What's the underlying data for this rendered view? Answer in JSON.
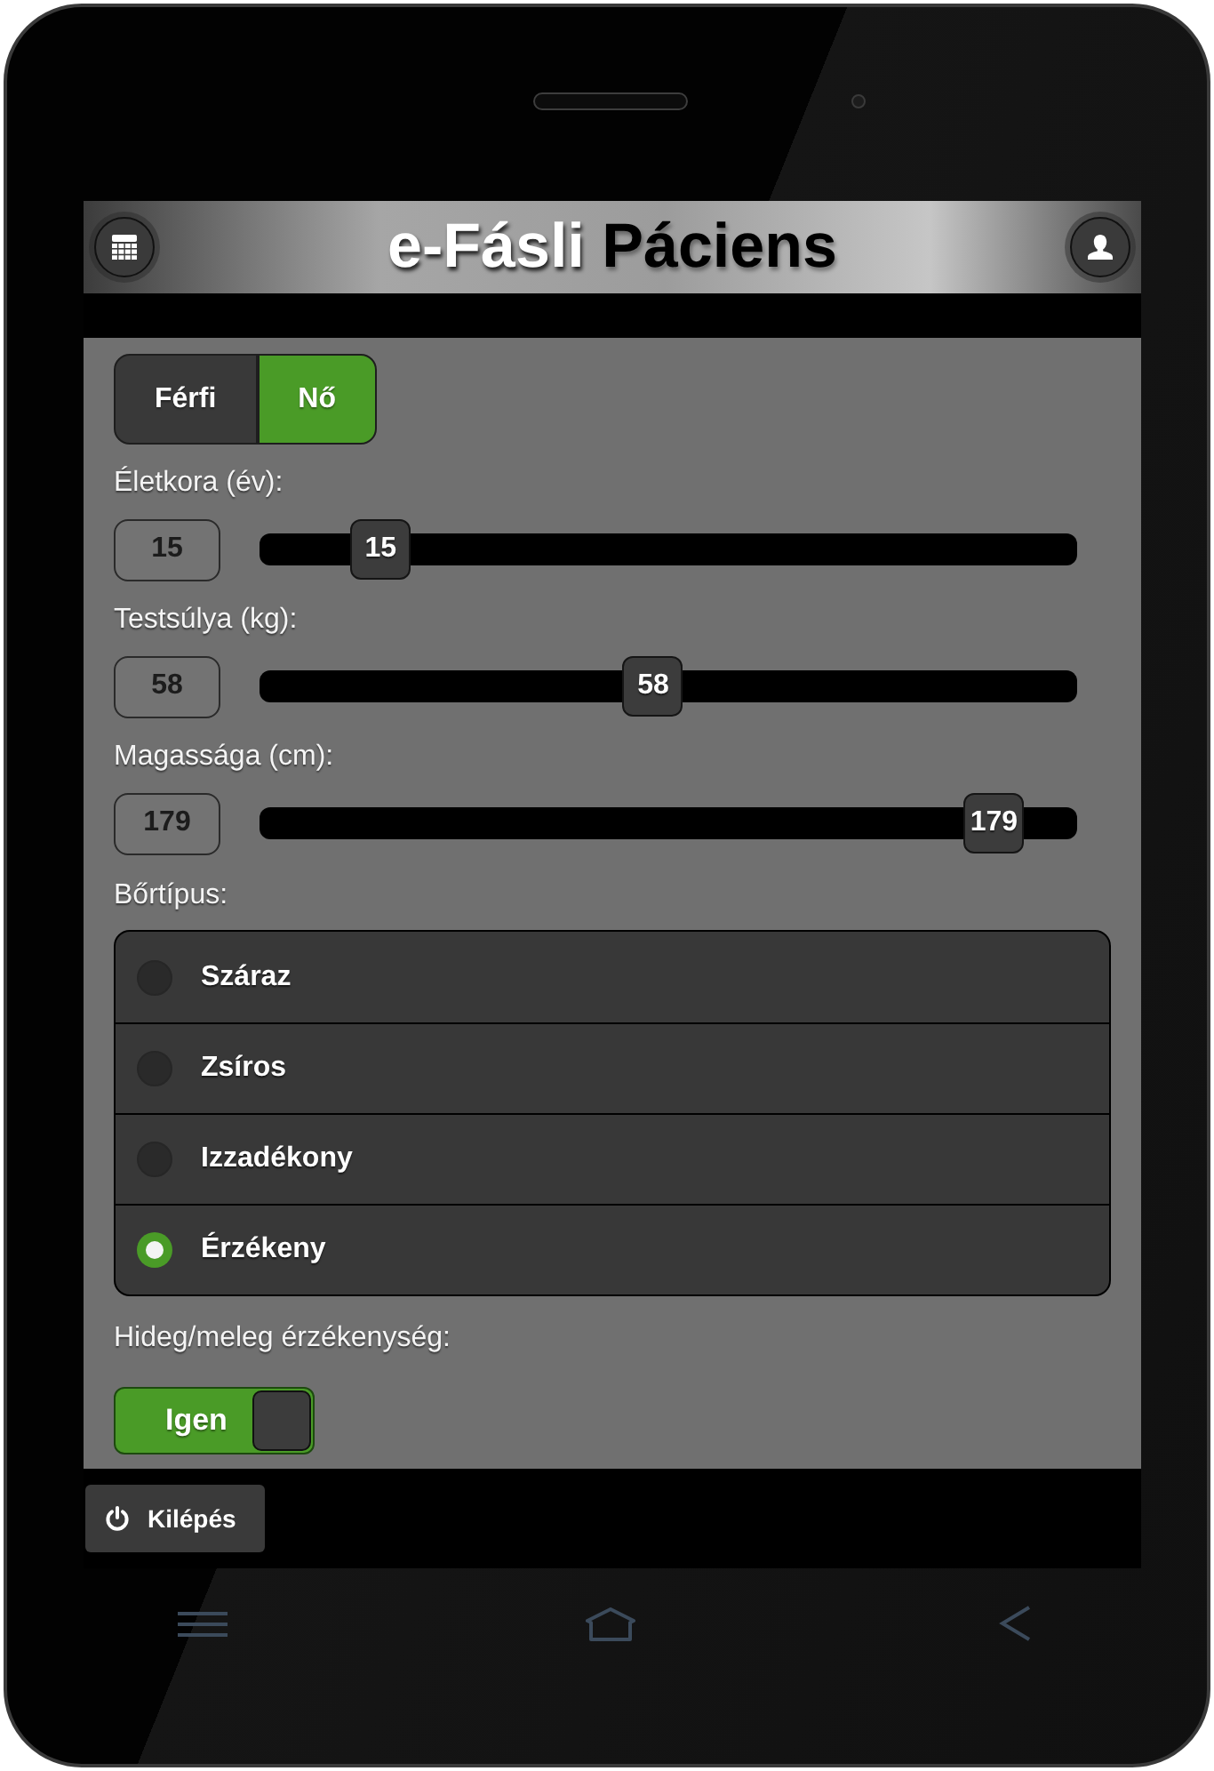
{
  "header": {
    "title_parts": [
      {
        "text": "e-Fásli",
        "kind": "light"
      },
      {
        "text": "Páciens",
        "kind": "dark"
      }
    ]
  },
  "gender": [
    {
      "label": "Férfi",
      "selected": false
    },
    {
      "label": "Nő",
      "selected": true
    }
  ],
  "sliders": [
    {
      "label": "Életkora (év):",
      "field_value": "15",
      "handle_value": "15",
      "level": 0.12
    },
    {
      "label": "Testsúlya (kg):",
      "field_value": "58",
      "handle_value": "58",
      "level": 0.48
    },
    {
      "label": "Magassága (cm):",
      "field_value": "179",
      "handle_value": "179",
      "level": 0.93
    }
  ],
  "skin_type": {
    "label": "Bőrtípus:",
    "options": [
      {
        "label": "Száraz",
        "selected": false
      },
      {
        "label": "Zsíros",
        "selected": false
      },
      {
        "label": "Izzadékony",
        "selected": false
      },
      {
        "label": "Érzékeny",
        "selected": true
      }
    ]
  },
  "sensitivity": {
    "label": "Hideg/meleg érzékenység:",
    "on": true,
    "switch_text": "Igen"
  },
  "footer": {
    "logout_button": "Kilépés"
  }
}
